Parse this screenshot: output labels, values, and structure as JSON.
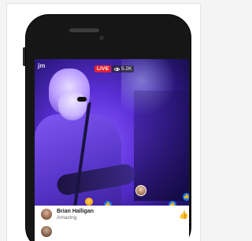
{
  "live": {
    "label": "LIVE",
    "viewers": "5.2K"
  },
  "app_logo": "jm",
  "comment": {
    "name": "Brian Halligan",
    "text": "Amazing"
  },
  "reactions": [
    {
      "name": "heart",
      "color": "#f33e58"
    },
    {
      "name": "like",
      "color": "#1877f2"
    },
    {
      "name": "like",
      "color": "#1877f2"
    },
    {
      "name": "haha",
      "color": "#f7b125"
    },
    {
      "name": "heart",
      "color": "#f33e58"
    },
    {
      "name": "like",
      "color": "#1877f2"
    }
  ]
}
